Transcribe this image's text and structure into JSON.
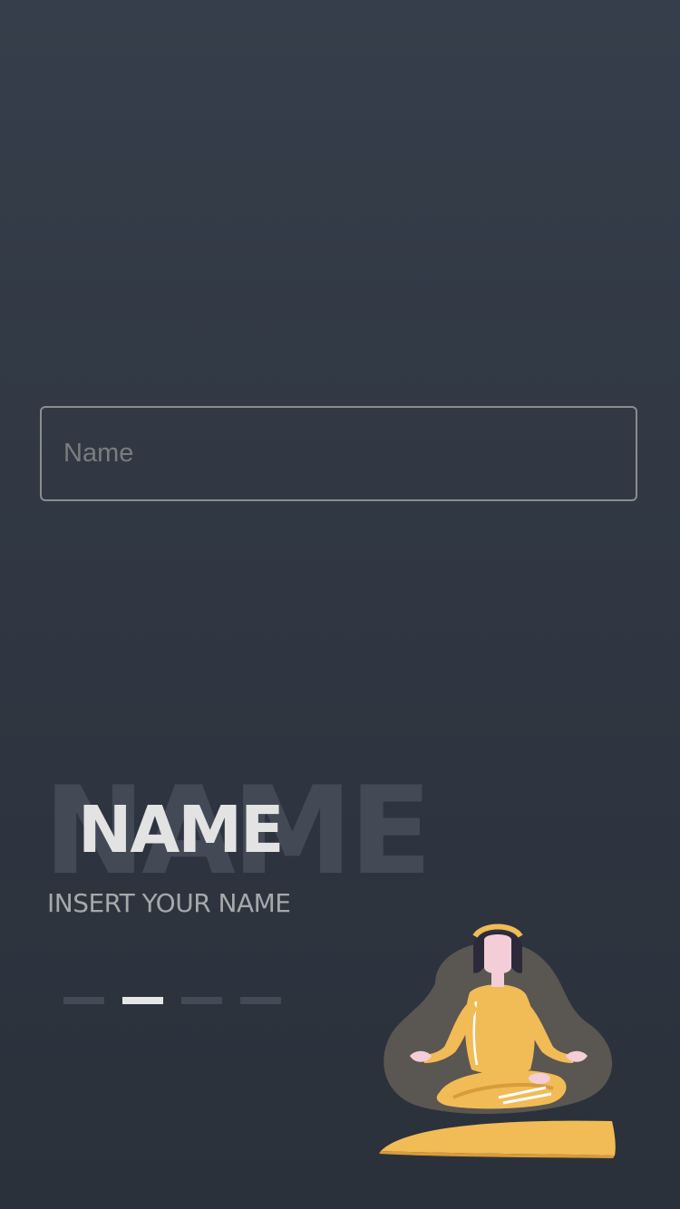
{
  "form": {
    "name_placeholder": "Name",
    "name_value": ""
  },
  "step": {
    "ghost_title": "NAME",
    "title": "NAME",
    "subtitle": "INSERT YOUR NAME"
  },
  "pager": {
    "total": 4,
    "active_index": 1
  },
  "illustration": {
    "icon": "meditating-woman-illustration",
    "colors": {
      "body": "#f1bb56",
      "blob": "#5a5651",
      "hair": "#2c2a3a",
      "skin": "#f3cdd8"
    }
  },
  "theme": {
    "background_top": "#363e4b",
    "background_bottom": "#2b313b",
    "accent": "#f1bb56"
  }
}
